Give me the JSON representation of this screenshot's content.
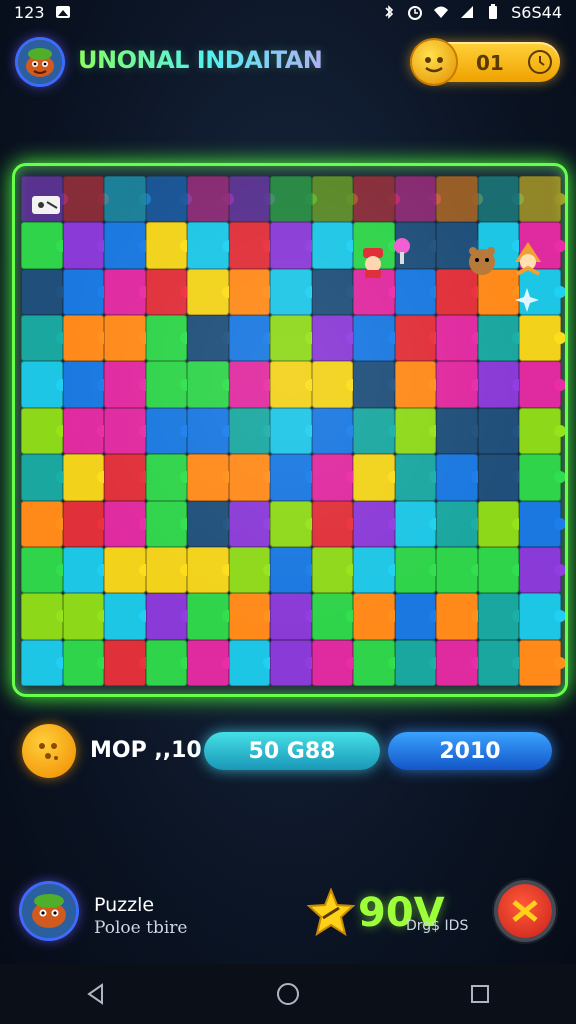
{
  "status_bar": {
    "time": "123",
    "right_text": "S6S44"
  },
  "header": {
    "title": "UNONAL INDAITAN",
    "coins": "01"
  },
  "colors": {
    "green": "#2fd44a",
    "cyan": "#1ec6e6",
    "blue": "#1a78e0",
    "orange": "#ff8a1a",
    "magenta": "#e02aa0",
    "purple": "#8a3ad6",
    "red": "#e0303a",
    "yellow": "#f2d21a",
    "teal": "#1aa7a0",
    "lime": "#8ed81a",
    "navy": "#1f4f7a"
  },
  "board": {
    "rows": 11,
    "cols": 13,
    "palette": [
      "green",
      "cyan",
      "blue",
      "orange",
      "magenta",
      "purple",
      "red",
      "yellow",
      "teal",
      "lime",
      "navy"
    ]
  },
  "stats": {
    "moves_label": "MOP ,,10",
    "score_pill": "50 G88",
    "level_pill": "2010"
  },
  "footer": {
    "title": "Puzzle",
    "subtitle": "Poloe tbire",
    "score": "90V",
    "score_sub": "Drg$ IDS"
  },
  "icons": {
    "avatar": "avatar-icon",
    "coin": "coin-icon",
    "clock": "clock-icon",
    "star": "star-icon",
    "close": "close-icon",
    "back": "back-icon",
    "home": "home-icon",
    "recent": "recent-apps-icon"
  }
}
